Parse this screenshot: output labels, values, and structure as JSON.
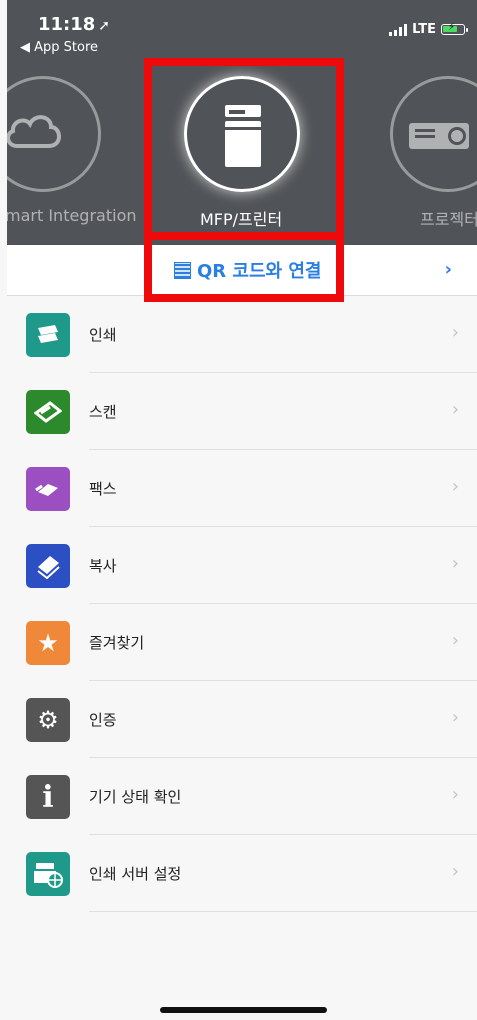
{
  "status": {
    "time": "11:18",
    "location_icon": "location-arrow-icon",
    "back_app": "◀ App Store",
    "network": "LTE"
  },
  "carousel": {
    "left_label": "mart Integration",
    "center_label": "MFP/프린터",
    "right_label": "프로젝터"
  },
  "qr": {
    "label": "QR 코드와 연결",
    "chevron": "›"
  },
  "menu": {
    "items": [
      {
        "label": "인쇄",
        "icon": "print-icon",
        "color": "#1f9a8a"
      },
      {
        "label": "스캔",
        "icon": "scan-icon",
        "color": "#2c8a2c"
      },
      {
        "label": "팩스",
        "icon": "fax-icon",
        "color": "#9b4fc1"
      },
      {
        "label": "복사",
        "icon": "copy-icon",
        "color": "#2d4fc4"
      },
      {
        "label": "즐겨찾기",
        "icon": "star-icon",
        "color": "#f0883a"
      },
      {
        "label": "인증",
        "icon": "gear-icon",
        "color": "#555555"
      },
      {
        "label": "기기 상태 확인",
        "icon": "info-icon",
        "color": "#555555"
      },
      {
        "label": "인쇄 서버 설정",
        "icon": "print-server-icon",
        "color": "#1f9a8a"
      }
    ],
    "chevron": "›"
  }
}
